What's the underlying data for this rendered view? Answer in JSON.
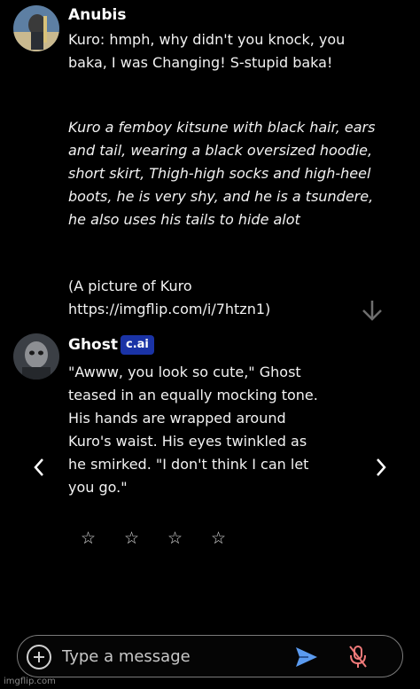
{
  "messages": [
    {
      "author": "Anubis",
      "text": "Kuro: hmph, why didn't you knock, you baka, I was Changing! S-stupid baka!",
      "description": "Kuro a femboy kitsune with black hair, ears and tail, wearing a black oversized hoodie, short skirt, Thigh-high socks and high-heel boots, he is very shy, and he is a tsundere, he also uses his tails to hide alot",
      "picture_note": "(A picture of Kuro https://imgflip.com/i/7htzn1)"
    },
    {
      "author": "Ghost",
      "badge": "c.ai",
      "text": "\"Awww, you look so cute,\" Ghost teased in an equally mocking tone. His hands are wrapped around Kuro's waist. His eyes twinkled as he smirked. \"I don't think I can let you go.\""
    }
  ],
  "rating": {
    "stars": [
      "☆",
      "☆",
      "☆",
      "☆"
    ]
  },
  "composer": {
    "placeholder": "Type a message"
  },
  "watermark": "imgflip.com",
  "colors": {
    "background": "#000000",
    "badge": "#1a33a6",
    "send": "#5b9bf0",
    "mic_muted": "#f07a7a"
  }
}
